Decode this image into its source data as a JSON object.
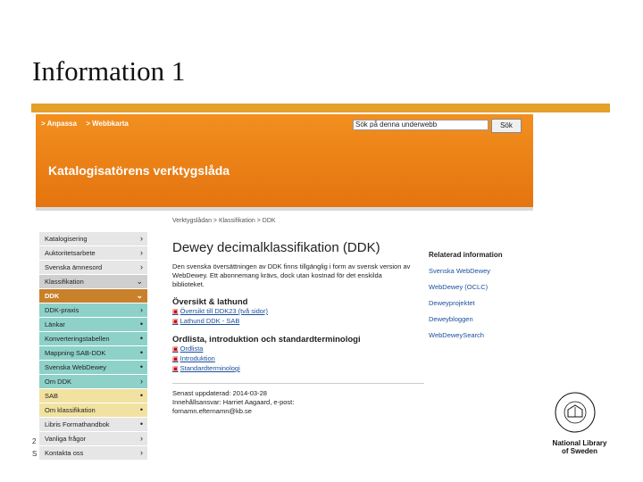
{
  "slide": {
    "title": "Information 1",
    "footer_left_1": "2",
    "footer_left_2": "S",
    "logo_text_line1": "National Library",
    "logo_text_line2": "of Sweden",
    "accent_color": "#e5a02a"
  },
  "site": {
    "toplinks": [
      "> Anpassa",
      "> Webbkarta"
    ],
    "search_value": "Sök på denna underwebb",
    "search_button": "Sök",
    "title": "Katalogisatörens verktygslåda"
  },
  "sidebar": {
    "items": [
      {
        "label": "Katalogisering",
        "chev": "›"
      },
      {
        "label": "Auktoritetsarbete",
        "chev": "›"
      },
      {
        "label": "Svenska ämnesord",
        "chev": "›"
      },
      {
        "label": "Klassifikation",
        "chev": "⌄"
      },
      {
        "label": "DDK",
        "chev": "⌄"
      },
      {
        "label": "DDK-praxis",
        "chev": "›"
      },
      {
        "label": "Länkar",
        "chev": "•"
      },
      {
        "label": "Konverteringstabellen",
        "chev": "•"
      },
      {
        "label": "Mappning SAB-DDK",
        "chev": "•"
      },
      {
        "label": "Svenska WebDewey",
        "chev": "•"
      },
      {
        "label": "Om DDK",
        "chev": "›"
      },
      {
        "label": "SAB",
        "chev": "•"
      },
      {
        "label": "Om klassifikation",
        "chev": "•"
      },
      {
        "label": "Libris Formathandbok",
        "chev": "•"
      },
      {
        "label": "Vanliga frågor",
        "chev": "›"
      },
      {
        "label": "Kontakta oss",
        "chev": "›"
      }
    ]
  },
  "main": {
    "breadcrumb": "Verktygslådan > Klassifikation > DDK",
    "heading": "Dewey decimalklassifikation (DDK)",
    "intro": "Den svenska översättningen av DDK finns tillgänglig i form av svensk version av WebDewey. Ett abonnemang krävs, dock utan kostnad för det enskilda biblioteket.",
    "section1_title": "Översikt & lathund",
    "section1_links": [
      "Översikt till DDK23 (två sidor)",
      "Lathund DDK - SAB"
    ],
    "section2_title": "Ordlista, introduktion och standardterminologi",
    "section2_links": [
      "Ordlista",
      "Introduktion",
      "Standardterminologi"
    ],
    "updated": "Senast uppdaterad: 2014-03-28",
    "owner": "Innehållsansvar: Harriet Aagaard, e-post:",
    "email": "fornamn.efternamn@kb.se"
  },
  "related": {
    "heading": "Relaterad information",
    "links": [
      "Svenska WebDewey",
      "WebDewey (OCLC)",
      "Deweyprojektet",
      "Deweybloggen",
      "WebDeweySearch"
    ]
  }
}
